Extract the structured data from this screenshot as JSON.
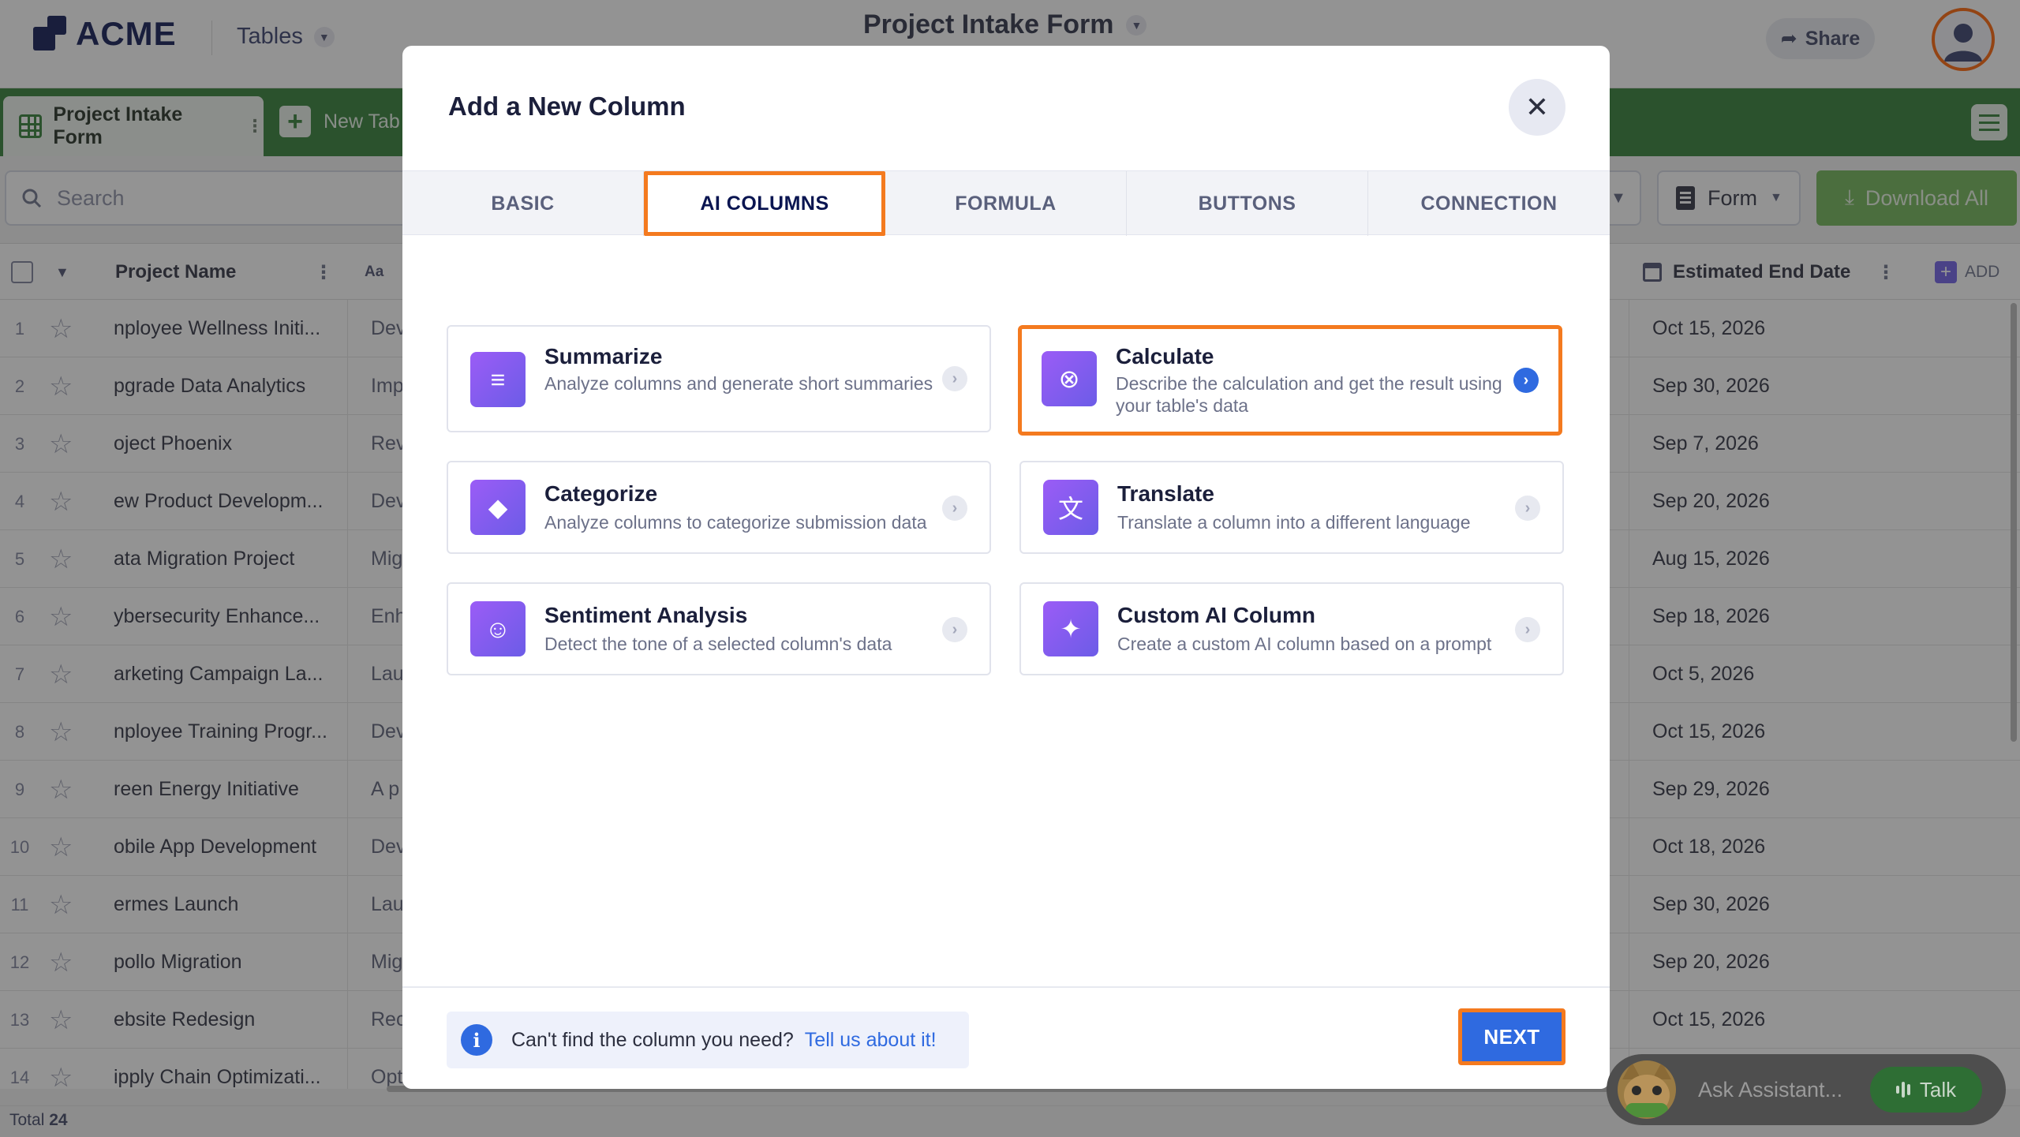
{
  "app": {
    "brand": "ACME",
    "tables_menu_label": "Tables",
    "form_title": "Project Intake Form",
    "share_label": "Share"
  },
  "tabbar": {
    "active_tab_label": "Project Intake Form",
    "new_tab_label": "New Tab"
  },
  "toolbar": {
    "search_placeholder": "Search",
    "view_dropdown_label": "Form",
    "download_label": "Download All"
  },
  "table": {
    "col_project_name": "Project Name",
    "col_text_type_glyph": "Aa",
    "col_estimated_end_date": "Estimated End Date",
    "add_column_label": "ADD",
    "rows": [
      {
        "num": "1",
        "name": "nployee Wellness Initi...",
        "desc": "Dev",
        "end": "Oct 15, 2026"
      },
      {
        "num": "2",
        "name": "pgrade Data Analytics",
        "desc": "Imp",
        "end": "Sep 30, 2026"
      },
      {
        "num": "3",
        "name": "oject Phoenix",
        "desc": "Rev",
        "end": "Sep 7, 2026"
      },
      {
        "num": "4",
        "name": "ew Product Developm...",
        "desc": "Dev",
        "end": "Sep 20, 2026"
      },
      {
        "num": "5",
        "name": "ata Migration Project",
        "desc": "Mig",
        "end": "Aug 15, 2026"
      },
      {
        "num": "6",
        "name": "ybersecurity Enhance...",
        "desc": "Enh",
        "end": "Sep 18, 2026"
      },
      {
        "num": "7",
        "name": "arketing Campaign La...",
        "desc": "Lau",
        "end": "Oct 5, 2026"
      },
      {
        "num": "8",
        "name": "nployee Training Progr...",
        "desc": "Dev",
        "end": "Oct 15, 2026"
      },
      {
        "num": "9",
        "name": "reen Energy Initiative",
        "desc": "A p",
        "end": "Sep 29, 2026"
      },
      {
        "num": "10",
        "name": "obile App Development",
        "desc": "Dev",
        "end": "Oct 18, 2026"
      },
      {
        "num": "11",
        "name": "ermes Launch",
        "desc": "Lau",
        "end": "Sep 30, 2026"
      },
      {
        "num": "12",
        "name": "pollo Migration",
        "desc": "Mig",
        "end": "Sep 20, 2026"
      },
      {
        "num": "13",
        "name": "ebsite Redesign",
        "desc": "Rec",
        "end": "Oct 15, 2026"
      },
      {
        "num": "14",
        "name": "ipply Chain Optimizati...",
        "desc": "Opt",
        "end": ""
      }
    ],
    "total_label": "Total",
    "total_count": "24"
  },
  "modal": {
    "title": "Add a New Column",
    "tabs": [
      {
        "label": "BASIC",
        "active": false
      },
      {
        "label": "AI COLUMNS",
        "active": true
      },
      {
        "label": "FORMULA",
        "active": false
      },
      {
        "label": "BUTTONS",
        "active": false
      },
      {
        "label": "CONNECTION",
        "active": false
      }
    ],
    "cards": [
      {
        "title": "Summarize",
        "desc": "Analyze columns and generate short summaries",
        "icon": "summarize-icon",
        "selected": false
      },
      {
        "title": "Calculate",
        "desc": "Describe the calculation and get the result using your table's data",
        "icon": "calculate-icon",
        "selected": true
      },
      {
        "title": "Categorize",
        "desc": "Analyze columns to categorize submission data",
        "icon": "categorize-icon",
        "selected": false
      },
      {
        "title": "Translate",
        "desc": "Translate a column into a different language",
        "icon": "translate-icon",
        "selected": false
      },
      {
        "title": "Sentiment Analysis",
        "desc": "Detect the tone of a selected column's data",
        "icon": "sentiment-icon",
        "selected": false
      },
      {
        "title": "Custom AI Column",
        "desc": "Create a custom AI column based on a prompt",
        "icon": "sparkle-icon",
        "selected": false
      }
    ],
    "hint_text": "Can't find the column you need?",
    "hint_link": "Tell us about it!",
    "next_label": "NEXT"
  },
  "assistant": {
    "placeholder": "Ask Assistant...",
    "talk_label": "Talk"
  },
  "colors": {
    "brand_navy": "#0a1551",
    "tab_green": "#2f7d32",
    "accent_blue": "#2f6ae0",
    "highlight_orange": "#f47a1f",
    "ai_purple": "#8b5cf6"
  }
}
